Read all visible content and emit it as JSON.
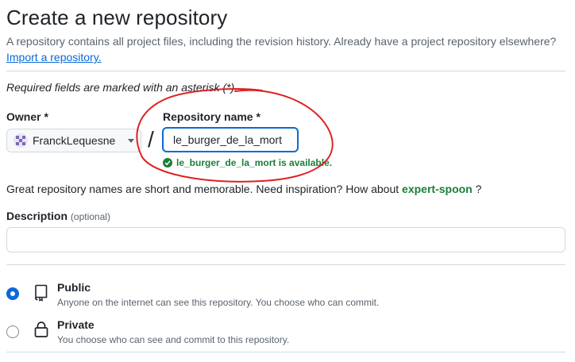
{
  "page": {
    "title": "Create a new repository",
    "intro": "A repository contains all project files, including the revision history. Already have a project repository elsewhere?",
    "import_link": "Import a repository.",
    "required_note": "Required fields are marked with an asterisk (*)."
  },
  "owner": {
    "label": "Owner *",
    "value": "FranckLequesne",
    "icon": "avatar-icon"
  },
  "separator": "/",
  "repo": {
    "label": "Repository name *",
    "value": "le_burger_de_la_mort",
    "availability": "le_burger_de_la_mort is available.",
    "availability_color": "#1a7f37"
  },
  "inspiration": {
    "text": "Great repository names are short and memorable. Need inspiration? How about",
    "suggestion": "expert-spoon",
    "suffix": "?"
  },
  "description": {
    "label": "Description",
    "optional": "(optional)",
    "value": ""
  },
  "visibility": {
    "selected": "public",
    "options": [
      {
        "key": "public",
        "title": "Public",
        "desc": "Anyone on the internet can see this repository. You choose who can commit.",
        "icon": "repo-icon"
      },
      {
        "key": "private",
        "title": "Private",
        "desc": "You choose who can see and commit to this repository.",
        "icon": "lock-icon"
      }
    ]
  },
  "colors": {
    "accent": "#0969da",
    "success": "#1a7f37",
    "annotation": "#e02020"
  }
}
